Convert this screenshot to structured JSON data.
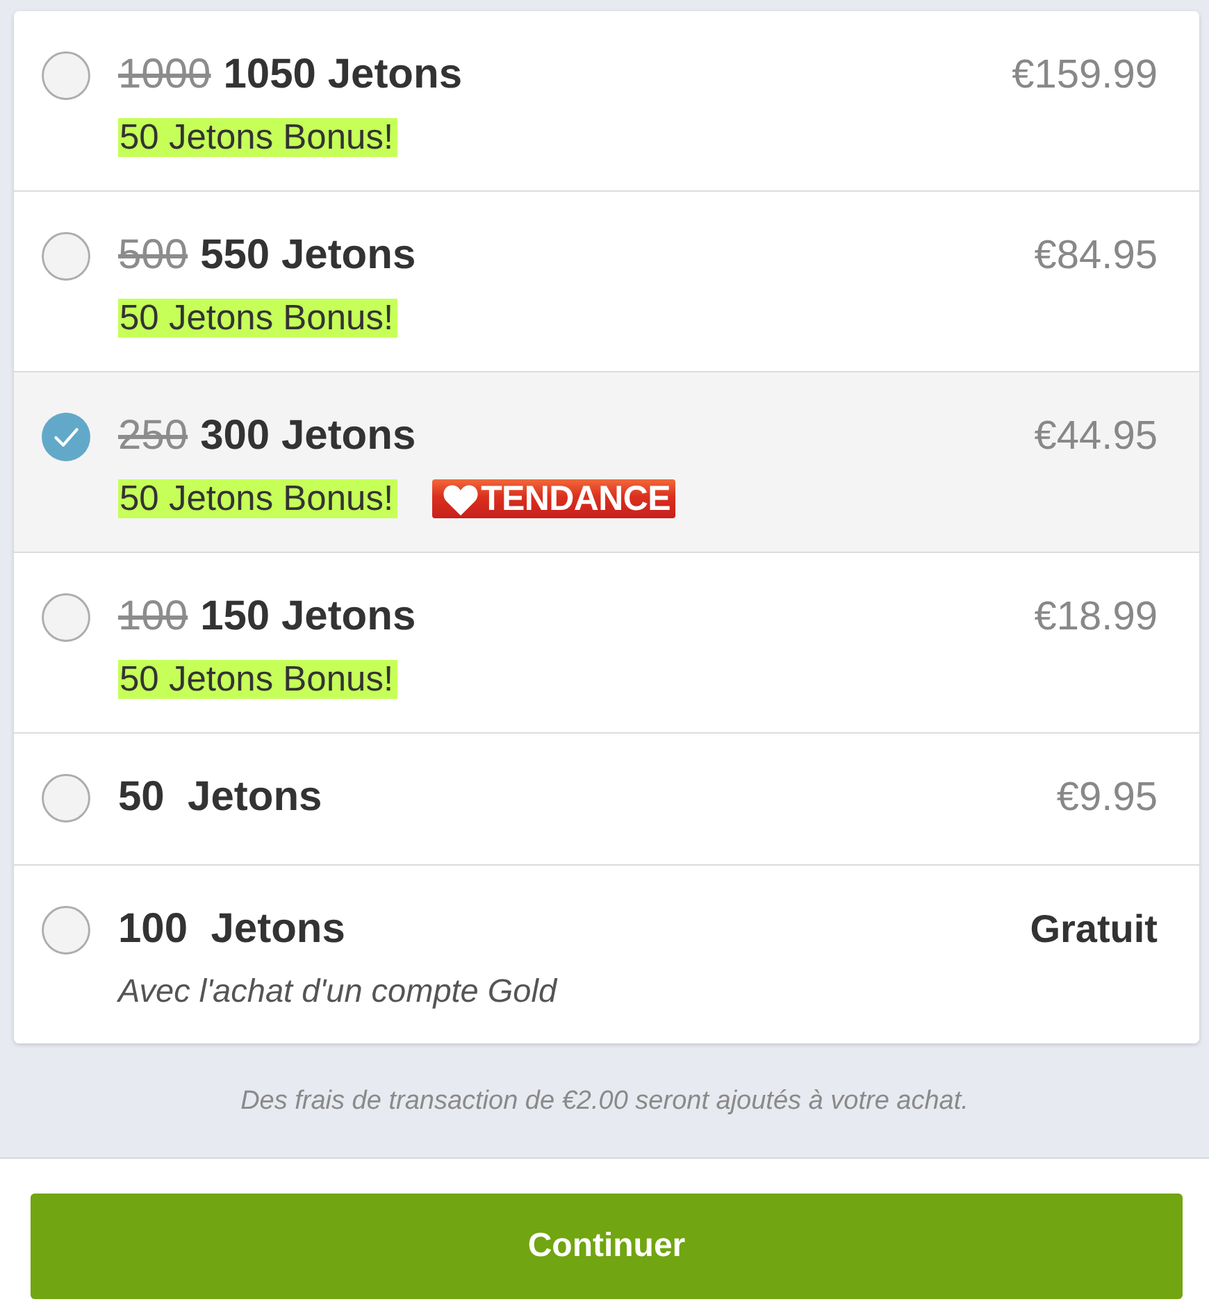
{
  "packages": [
    {
      "kind": "bonus",
      "selected": false,
      "old_quantity": "1000",
      "quantity": "1050 Jetons",
      "price": "€159.99",
      "bonus": "50 Jetons Bonus!"
    },
    {
      "kind": "bonus",
      "selected": false,
      "old_quantity": "500",
      "quantity": "550 Jetons",
      "price": "€84.95",
      "bonus": "50 Jetons Bonus!"
    },
    {
      "kind": "bonus",
      "selected": true,
      "old_quantity": "250",
      "quantity": "300 Jetons",
      "price": "€44.95",
      "bonus": "50 Jetons Bonus!",
      "tag": "TENDANCE"
    },
    {
      "kind": "bonus",
      "selected": false,
      "old_quantity": "100",
      "quantity": "150 Jetons",
      "price": "€18.99",
      "bonus": "50 Jetons Bonus!"
    },
    {
      "kind": "plain",
      "selected": false,
      "quantity": "50  Jetons",
      "price": "€9.95"
    },
    {
      "kind": "free",
      "selected": false,
      "quantity": "100  Jetons",
      "price": "Gratuit",
      "note": "Avec l'achat d'un compte Gold"
    }
  ],
  "fee_note": "Des frais de transaction de €2.00 seront ajoutés à votre achat.",
  "continue_button": "Continuer"
}
